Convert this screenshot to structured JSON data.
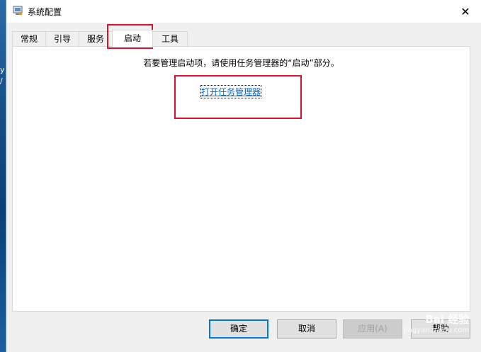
{
  "desktop": {
    "left_text_1": "y",
    "left_text_2": "/"
  },
  "window": {
    "title": "系统配置",
    "close_glyph": "✕"
  },
  "tabs": [
    {
      "label": "常规",
      "active": false
    },
    {
      "label": "引导",
      "active": false
    },
    {
      "label": "服务",
      "active": false
    },
    {
      "label": "启动",
      "active": true
    },
    {
      "label": "工具",
      "active": false
    }
  ],
  "startup_panel": {
    "info_text": "若要管理启动项，请使用任务管理器的“启动”部分。",
    "link_text": "打开任务管理器"
  },
  "buttons": {
    "ok": "确定",
    "cancel": "取消",
    "apply": "应用(A)",
    "help": "帮助"
  },
  "watermark": {
    "line1": "Bai 经验",
    "line2": "jingyan.baidu.com"
  },
  "colors": {
    "link": "#0066cc",
    "highlight": "#e0102a",
    "default_button_border": "#0078d7"
  }
}
